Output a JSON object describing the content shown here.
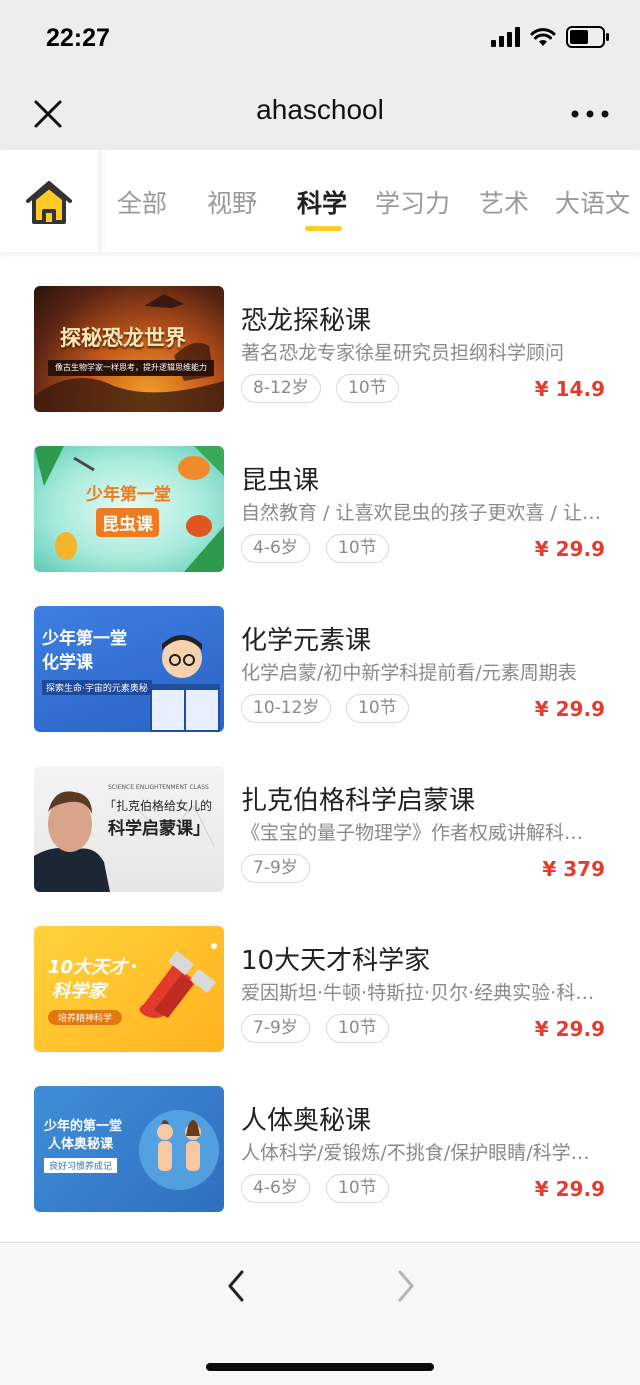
{
  "status_bar": {
    "time": "22:27"
  },
  "nav": {
    "title": "ahaschool"
  },
  "tabs": [
    {
      "label": "全部"
    },
    {
      "label": "视野"
    },
    {
      "label": "科学"
    },
    {
      "label": "学习力"
    },
    {
      "label": "艺术"
    },
    {
      "label": "大语文"
    }
  ],
  "active_tab": "科学",
  "courses": [
    {
      "title": "恐龙探秘课",
      "desc": "著名恐龙专家徐星研究员担纲科学顾问",
      "age": "8-12岁",
      "lessons": "10节",
      "price": "¥ 14.9",
      "thumb_text": "探秘恐龙世界",
      "thumb_sub": "像古生物学家一样思考，提升逻辑思维能力"
    },
    {
      "title": "昆虫课",
      "desc": "自然教育 / 让喜欢昆虫的孩子更欢喜 / 让害怕昆虫的孩子不再害怕",
      "age": "4-6岁",
      "lessons": "10节",
      "price": "¥ 29.9",
      "thumb_text": "少年第一堂",
      "thumb_sub": "昆虫课"
    },
    {
      "title": "化学元素课",
      "desc": "化学启蒙/初中新学科提前看/元素周期表",
      "age": "10-12岁",
      "lessons": "10节",
      "price": "¥ 29.9",
      "thumb_text": "少年第一堂",
      "thumb_sub": "化学课",
      "thumb_note": "探索生命·宇宙的元素奥秘"
    },
    {
      "title": "扎克伯格科学启蒙课",
      "desc": "《宝宝的量子物理学》作者权威讲解科学启蒙",
      "age": "7-9岁",
      "price": "¥ 379",
      "thumb_header": "SCIENCE ENLIGHTENMENT CLASS",
      "thumb_text": "「扎克伯格给女儿的",
      "thumb_sub": "科学启蒙课」"
    },
    {
      "title": "10大天才科学家",
      "desc": "爱因斯坦·牛顿·特斯拉·贝尔·经典实验·科学精神",
      "age": "7-9岁",
      "lessons": "10节",
      "price": "¥ 29.9",
      "thumb_text": "10大天才",
      "thumb_sub": "科学家",
      "thumb_note": "培养精神科学"
    },
    {
      "title": "人体奥秘课",
      "desc": "人体科学/爱锻炼/不挑食/保护眼睛/科学用脑",
      "age": "4-6岁",
      "lessons": "10节",
      "price": "¥ 29.9",
      "thumb_text": "少年的第一堂",
      "thumb_sub": "人体奥秘课",
      "thumb_note": "良好习惯养成记"
    }
  ],
  "colors": {
    "accent": "#ffcc22",
    "price": "#e63c2f",
    "nav_bg": "#ededed"
  }
}
